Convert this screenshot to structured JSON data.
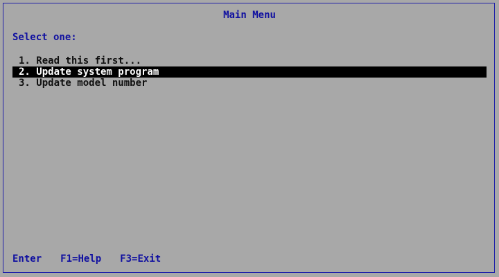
{
  "screen": {
    "title": "Main Menu",
    "prompt": "Select one:"
  },
  "menu": {
    "items": [
      {
        "label": "1. Read this first..."
      },
      {
        "label": "2. Update system program"
      },
      {
        "label": "3. Update model number"
      }
    ],
    "selected_index": 1
  },
  "footer": {
    "keys": [
      {
        "label": "Enter"
      },
      {
        "label": "F1=Help"
      },
      {
        "label": "F3=Exit"
      }
    ]
  },
  "colors": {
    "background": "#a8a8a8",
    "text_blue": "#1010a0",
    "highlight": "#000000"
  }
}
